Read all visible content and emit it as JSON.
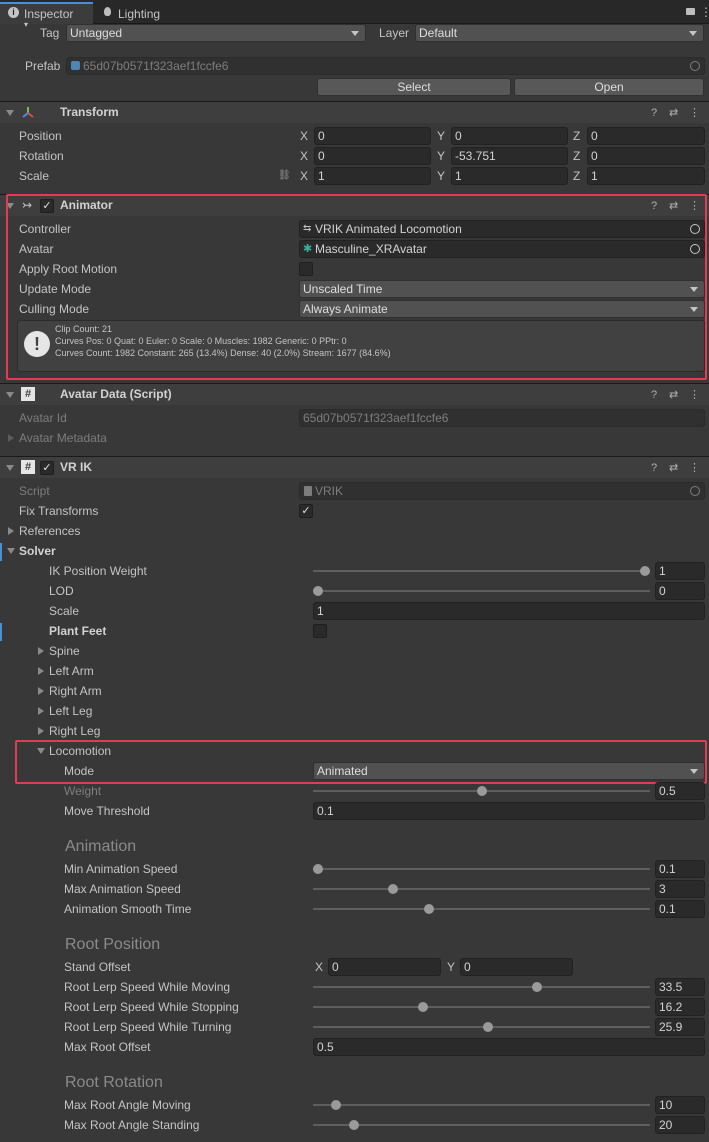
{
  "tabs": [
    {
      "label": "Inspector",
      "icon": "info-icon"
    },
    {
      "label": "Lighting",
      "icon": "bulb-icon"
    }
  ],
  "object": {
    "tag_label": "Tag",
    "tag_value": "Untagged",
    "layer_label": "Layer",
    "layer_value": "Default",
    "prefab_label": "Prefab",
    "prefab_value": "65d07b0571f323aef1fccfe6",
    "select_label": "Select",
    "open_label": "Open"
  },
  "transform": {
    "title": "Transform",
    "position_label": "Position",
    "rotation_label": "Rotation",
    "scale_label": "Scale",
    "x": "X",
    "y": "Y",
    "z": "Z",
    "position": [
      "0",
      "0",
      "0"
    ],
    "rotation": [
      "0",
      "-53.751",
      "0"
    ],
    "scale": [
      "1",
      "1",
      "1"
    ]
  },
  "animator": {
    "title": "Animator",
    "controller_label": "Controller",
    "controller_value": "VRIK Animated Locomotion",
    "avatar_label": "Avatar",
    "avatar_value": "Masculine_XRAvatar",
    "root_motion_label": "Apply Root Motion",
    "update_mode_label": "Update Mode",
    "update_mode_value": "Unscaled Time",
    "culling_label": "Culling Mode",
    "culling_value": "Always Animate",
    "info_line1": "Clip Count: 21",
    "info_line2": "Curves Pos: 0 Quat: 0 Euler: 0 Scale: 0 Muscles: 1982 Generic: 0 PPtr: 0",
    "info_line3": "Curves Count: 1982 Constant: 265 (13.4%) Dense: 40 (2.0%) Stream: 1677 (84.6%)"
  },
  "avatar_data": {
    "title": "Avatar Data (Script)",
    "id_label": "Avatar Id",
    "id_value": "65d07b0571f323aef1fccfe6",
    "metadata_label": "Avatar Metadata"
  },
  "vrik": {
    "title": "VR IK",
    "script_label": "Script",
    "script_value": "VRIK",
    "fix_label": "Fix Transforms",
    "references_label": "References",
    "solver_label": "Solver",
    "ik_weight_label": "IK Position Weight",
    "ik_weight_value": "1",
    "lod_label": "LOD",
    "lod_value": "0",
    "scale_label": "Scale",
    "scale_value": "1",
    "plant_feet_label": "Plant Feet",
    "spine_label": "Spine",
    "left_arm_label": "Left Arm",
    "right_arm_label": "Right Arm",
    "left_leg_label": "Left Leg",
    "right_leg_label": "Right Leg",
    "locomotion_label": "Locomotion",
    "mode_label": "Mode",
    "mode_value": "Animated",
    "weight_label": "Weight",
    "weight_value": "0.5",
    "move_threshold_label": "Move Threshold",
    "move_threshold_value": "0.1",
    "animation_header": "Animation",
    "min_speed_label": "Min Animation Speed",
    "min_speed_value": "0.1",
    "max_speed_label": "Max Animation Speed",
    "max_speed_value": "3",
    "smooth_label": "Animation Smooth Time",
    "smooth_value": "0.1",
    "root_position_header": "Root Position",
    "stand_offset_label": "Stand Offset",
    "stand_x": "0",
    "stand_y": "0",
    "lerp_moving_label": "Root Lerp Speed While Moving",
    "lerp_moving_value": "33.5",
    "lerp_stopping_label": "Root Lerp Speed While Stopping",
    "lerp_stopping_value": "16.2",
    "lerp_turning_label": "Root Lerp Speed While Turning",
    "lerp_turning_value": "25.9",
    "max_offset_label": "Max Root Offset",
    "max_offset_value": "0.5",
    "root_rotation_header": "Root Rotation",
    "angle_moving_label": "Max Root Angle Moving",
    "angle_moving_value": "10",
    "angle_standing_label": "Max Root Angle Standing",
    "angle_standing_value": "20"
  },
  "colors": {
    "highlight": "#e23c52",
    "background": "#383838"
  }
}
